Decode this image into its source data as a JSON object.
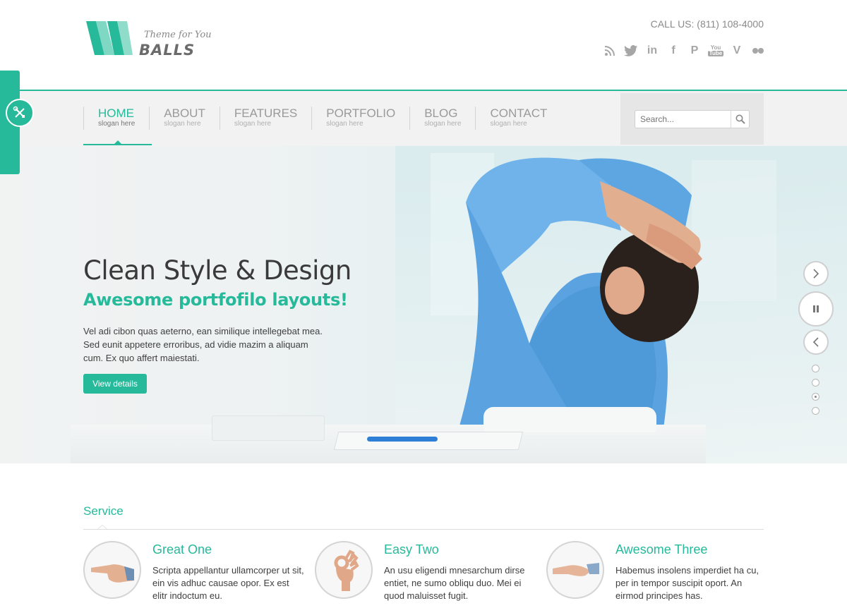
{
  "colors": {
    "accent": "#26b99a",
    "nav_bg": "#f2f2f2",
    "text": "#3f3f3f"
  },
  "logo": {
    "tagline": "Theme for You",
    "name": "BALLS"
  },
  "header": {
    "call_us": "CALL US: (811) 108-4000",
    "social": [
      "rss-icon",
      "twitter-icon",
      "linkedin-icon",
      "facebook-icon",
      "pinterest-icon",
      "youtube-icon",
      "vimeo-icon",
      "flickr-icon"
    ],
    "social_labels": {
      "linkedin": "in",
      "facebook": "f",
      "pinterest": "P",
      "youtube_top": "You",
      "youtube_bottom": "Tube",
      "vimeo": "V"
    }
  },
  "nav": {
    "items": [
      {
        "title": "HOME",
        "slogan": "slogan here",
        "active": true
      },
      {
        "title": "ABOUT",
        "slogan": "slogan here"
      },
      {
        "title": "FEATURES",
        "slogan": "slogan here"
      },
      {
        "title": "PORTFOLIO",
        "slogan": "slogan here"
      },
      {
        "title": "BLOG",
        "slogan": "slogan here"
      },
      {
        "title": "CONTACT",
        "slogan": "slogan here"
      }
    ]
  },
  "search": {
    "placeholder": "Search..."
  },
  "hero": {
    "title": "Clean Style & Design",
    "subtitle": "Awesome portfofilo layouts!",
    "text": "Vel adi cibon quas aeterno, ean similique intellegebat mea. Sed eunit appetere erroribus, ad vidie mazim a aliquam cum. Ex quo affert maiestati.",
    "button": "View details",
    "slide_count": 4,
    "active_slide": 3
  },
  "service": {
    "title": "Service",
    "items": [
      {
        "heading": "Great One",
        "text": "Scripta appellantur ullamcorper ut sit, ein vis adhuc causae opor. Ex est elitr indoctum eu.",
        "icon": "pointing-hand-icon"
      },
      {
        "heading": "Easy Two",
        "text": "An usu eligendi mnesarchum dirse entiet, ne sumo obliqu duo. Mei ei quod maluisset fugit.",
        "icon": "ok-hand-icon"
      },
      {
        "heading": "Awesome Three",
        "text": "Habemus insolens imperdiet ha cu, per in tempor suscipit oport. An eirmod principes has.",
        "icon": "handshake-icon"
      }
    ]
  }
}
